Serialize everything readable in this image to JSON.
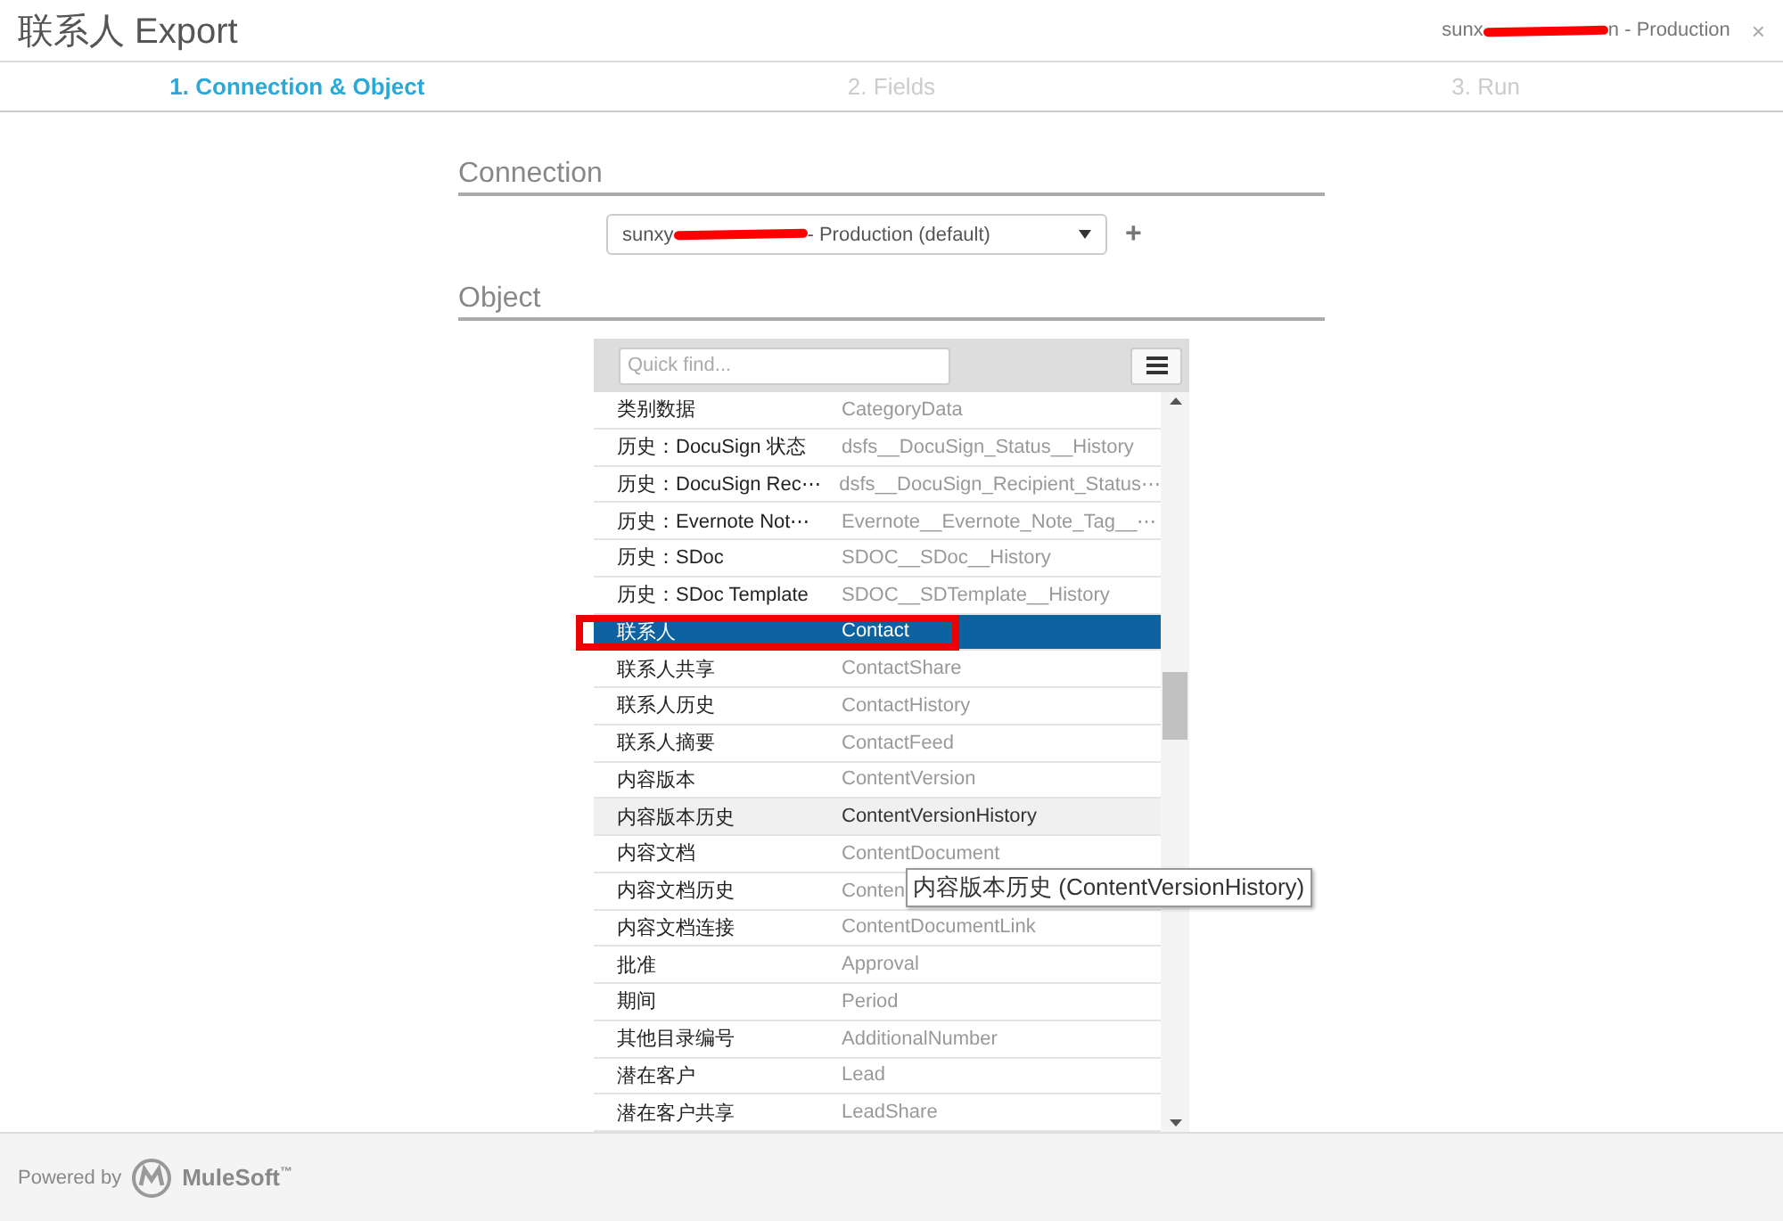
{
  "header": {
    "title": "联系人 Export",
    "account_prefix": "sunx",
    "account_suffix": "n - Production",
    "close": "×"
  },
  "steps": [
    {
      "label": "1. Connection & Object",
      "selected": true
    },
    {
      "label": "2. Fields",
      "selected": false
    },
    {
      "label": "3. Run",
      "selected": false
    }
  ],
  "connection": {
    "heading": "Connection",
    "value_prefix": "sunxy",
    "value_suffix": "- Production (default)",
    "add": "+"
  },
  "object": {
    "heading": "Object",
    "search": {
      "placeholder": "Quick find..."
    },
    "rows": [
      {
        "label": "类别数据",
        "api_name": "CategoryData",
        "selected": false,
        "hovered": false
      },
      {
        "label": "历史：DocuSign 状态",
        "api_name": "dsfs__DocuSign_Status__History",
        "selected": false,
        "hovered": false
      },
      {
        "label": "历史：DocuSign Rec⋯",
        "api_name": "dsfs__DocuSign_Recipient_Status⋯",
        "selected": false,
        "hovered": false
      },
      {
        "label": "历史：Evernote Not⋯",
        "api_name": "Evernote__Evernote_Note_Tag__⋯",
        "selected": false,
        "hovered": false
      },
      {
        "label": "历史：SDoc",
        "api_name": "SDOC__SDoc__History",
        "selected": false,
        "hovered": false
      },
      {
        "label": "历史：SDoc Template",
        "api_name": "SDOC__SDTemplate__History",
        "selected": false,
        "hovered": false
      },
      {
        "label": "联系人",
        "api_name": "Contact",
        "selected": true,
        "hovered": false,
        "annotated": true
      },
      {
        "label": "联系人共享",
        "api_name": "ContactShare",
        "selected": false,
        "hovered": false
      },
      {
        "label": "联系人历史",
        "api_name": "ContactHistory",
        "selected": false,
        "hovered": false
      },
      {
        "label": "联系人摘要",
        "api_name": "ContactFeed",
        "selected": false,
        "hovered": false
      },
      {
        "label": "内容版本",
        "api_name": "ContentVersion",
        "selected": false,
        "hovered": false
      },
      {
        "label": "内容版本历史",
        "api_name": "ContentVersionHistory",
        "selected": false,
        "hovered": true
      },
      {
        "label": "内容文档",
        "api_name": "ContentDocument",
        "selected": false,
        "hovered": false
      },
      {
        "label": "内容文档历史",
        "api_name": "Conten",
        "selected": false,
        "hovered": false,
        "tooltip": "内容版本历史 (ContentVersionHistory)"
      },
      {
        "label": "内容文档连接",
        "api_name": "ContentDocumentLink",
        "selected": false,
        "hovered": false
      },
      {
        "label": "批准",
        "api_name": "Approval",
        "selected": false,
        "hovered": false
      },
      {
        "label": "期间",
        "api_name": "Period",
        "selected": false,
        "hovered": false
      },
      {
        "label": "其他目录编号",
        "api_name": "AdditionalNumber",
        "selected": false,
        "hovered": false
      },
      {
        "label": "潜在客户",
        "api_name": "Lead",
        "selected": false,
        "hovered": false
      },
      {
        "label": "潜在客户共享",
        "api_name": "LeadShare",
        "selected": false,
        "hovered": false
      }
    ]
  },
  "footer": {
    "powered_by": "Powered by",
    "brand": "MuleSoft",
    "trademark": "™"
  }
}
